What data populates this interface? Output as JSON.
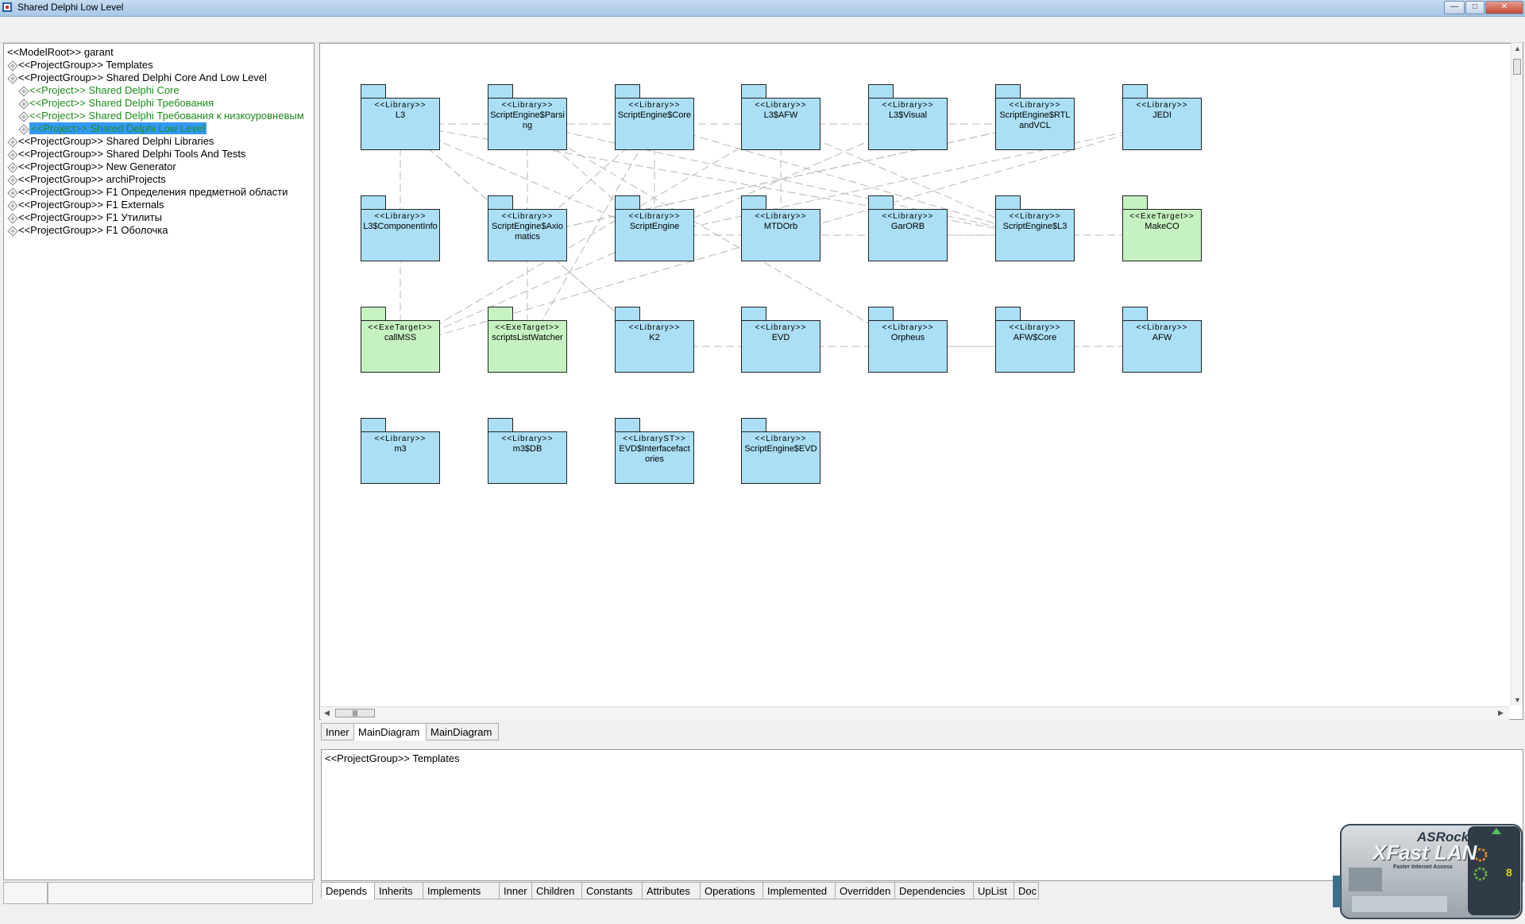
{
  "window": {
    "title": "Shared Delphi Low Level"
  },
  "tree": {
    "items": [
      {
        "label": "<<ModelRoot>> garant",
        "level": 0,
        "kind": "root"
      },
      {
        "label": "<<ProjectGroup>> Templates",
        "level": 1,
        "kind": "group"
      },
      {
        "label": "<<ProjectGroup>> Shared Delphi Core And Low Level",
        "level": 1,
        "kind": "group"
      },
      {
        "label": "<<Project>> Shared Delphi Core",
        "level": 2,
        "kind": "project"
      },
      {
        "label": "<<Project>> Shared Delphi Требования",
        "level": 2,
        "kind": "project"
      },
      {
        "label": "<<Project>> Shared Delphi Требования к низкоуровневым",
        "level": 2,
        "kind": "project"
      },
      {
        "label": "<<Project>> Shared Delphi Low Level",
        "level": 2,
        "kind": "project",
        "selected": true
      },
      {
        "label": "<<ProjectGroup>> Shared Delphi Libraries",
        "level": 1,
        "kind": "group"
      },
      {
        "label": "<<ProjectGroup>> Shared Delphi Tools And Tests",
        "level": 1,
        "kind": "group"
      },
      {
        "label": "<<ProjectGroup>> New Generator",
        "level": 1,
        "kind": "group"
      },
      {
        "label": "<<ProjectGroup>> archiProjects",
        "level": 1,
        "kind": "group"
      },
      {
        "label": "<<ProjectGroup>> F1 Определения предметной области",
        "level": 1,
        "kind": "group"
      },
      {
        "label": "<<ProjectGroup>> F1 Externals",
        "level": 1,
        "kind": "group"
      },
      {
        "label": "<<ProjectGroup>> F1 Утилиты",
        "level": 1,
        "kind": "group"
      },
      {
        "label": "<<ProjectGroup>> F1 Оболочка",
        "level": 1,
        "kind": "group"
      }
    ]
  },
  "diagram": {
    "packages": [
      {
        "stereotype": "<<Library>>",
        "name": "L3",
        "kind": "library"
      },
      {
        "stereotype": "<<Library>>",
        "name": "ScriptEngine$Parsing",
        "kind": "library"
      },
      {
        "stereotype": "<<Library>>",
        "name": "ScriptEngine$Core",
        "kind": "library"
      },
      {
        "stereotype": "<<Library>>",
        "name": "L3$AFW",
        "kind": "library"
      },
      {
        "stereotype": "<<Library>>",
        "name": "L3$Visual",
        "kind": "library"
      },
      {
        "stereotype": "<<Library>>",
        "name": "ScriptEngine$RTLandVCL",
        "kind": "library"
      },
      {
        "stereotype": "<<Library>>",
        "name": "JEDI",
        "kind": "library"
      },
      {
        "stereotype": "<<Library>>",
        "name": "L3$ComponentInfo",
        "kind": "library"
      },
      {
        "stereotype": "<<Library>>",
        "name": "ScriptEngine$Axiomatics",
        "kind": "library"
      },
      {
        "stereotype": "<<Library>>",
        "name": "ScriptEngine",
        "kind": "library"
      },
      {
        "stereotype": "<<Library>>",
        "name": "MTDOrb",
        "kind": "library"
      },
      {
        "stereotype": "<<Library>>",
        "name": "GarORB",
        "kind": "library"
      },
      {
        "stereotype": "<<Library>>",
        "name": "ScriptEngine$L3",
        "kind": "library"
      },
      {
        "stereotype": "<<ExeTarget>>",
        "name": "MakeCO",
        "kind": "exe"
      },
      {
        "stereotype": "<<ExeTarget>>",
        "name": "callMSS",
        "kind": "exe"
      },
      {
        "stereotype": "<<ExeTarget>>",
        "name": "scriptsListWatcher",
        "kind": "exe"
      },
      {
        "stereotype": "<<Library>>",
        "name": "K2",
        "kind": "library"
      },
      {
        "stereotype": "<<Library>>",
        "name": "EVD",
        "kind": "library"
      },
      {
        "stereotype": "<<Library>>",
        "name": "Orpheus",
        "kind": "library"
      },
      {
        "stereotype": "<<Library>>",
        "name": "AFW$Core",
        "kind": "library"
      },
      {
        "stereotype": "<<Library>>",
        "name": "AFW",
        "kind": "library"
      },
      {
        "stereotype": "<<Library>>",
        "name": "m3",
        "kind": "library"
      },
      {
        "stereotype": "<<Library>>",
        "name": "m3$DB",
        "kind": "library"
      },
      {
        "stereotype": "<<LibraryST>>",
        "name": "EVD$Interfacefactories",
        "kind": "library"
      },
      {
        "stereotype": "<<Library>>",
        "name": "ScriptEngine$EVD",
        "kind": "library"
      }
    ],
    "colors": {
      "library": "#aadff5",
      "exe": "#c5f2c0"
    }
  },
  "diagram_tabs": [
    {
      "label": "Inner",
      "active": false
    },
    {
      "label": "MainDiagram",
      "active": true
    },
    {
      "label": "MainDiagram",
      "active": false
    }
  ],
  "info": {
    "text": "<<ProjectGroup>> Templates"
  },
  "bottom_tabs": [
    {
      "label": "Depends",
      "active": true
    },
    {
      "label": "Inherits"
    },
    {
      "label": "Implements"
    },
    {
      "label": "Inner"
    },
    {
      "label": "Children"
    },
    {
      "label": "Constants"
    },
    {
      "label": "Attributes"
    },
    {
      "label": "Operations"
    },
    {
      "label": "Implemented"
    },
    {
      "label": "Overridden"
    },
    {
      "label": "Dependencies"
    },
    {
      "label": "UpList"
    },
    {
      "label": "Doc"
    }
  ],
  "widget": {
    "brand": "ASRock",
    "product": "XFast LAN",
    "tagline": "Faster Internet Access",
    "count": "8"
  }
}
